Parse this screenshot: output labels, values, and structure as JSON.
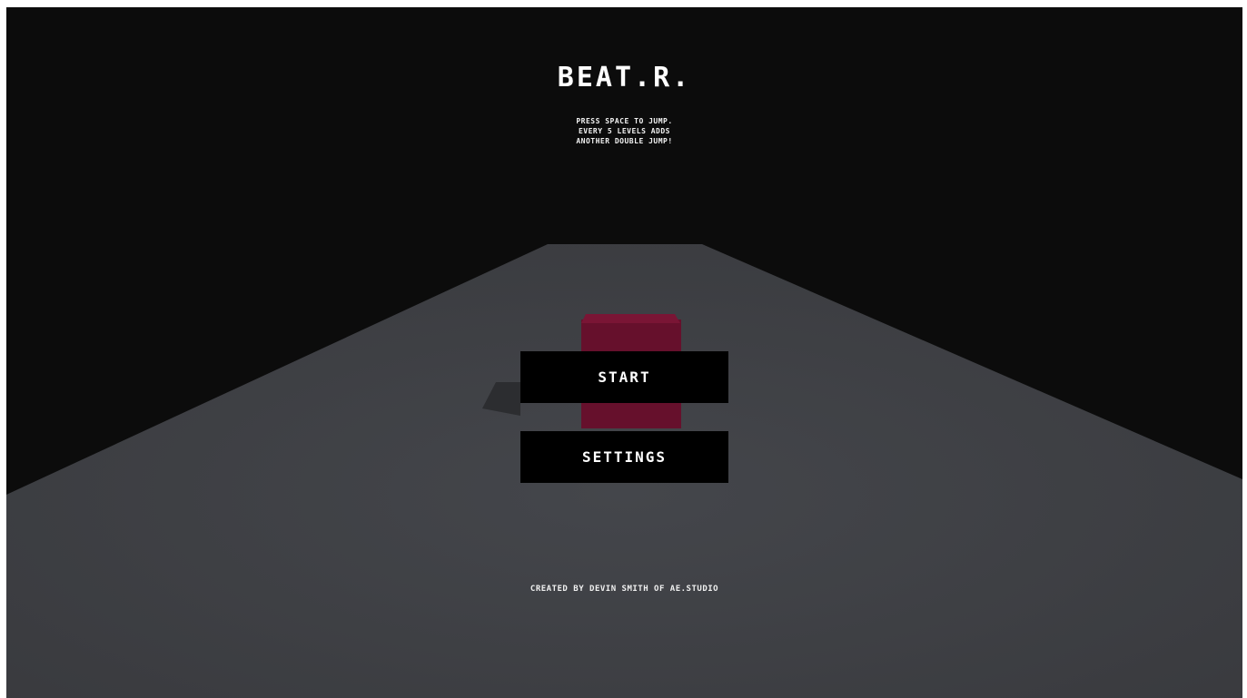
{
  "game": {
    "title": "BEAT.R.",
    "instructions": [
      "PRESS SPACE TO JUMP.",
      "EVERY 5 LEVELS ADDS",
      "ANOTHER DOUBLE JUMP!"
    ],
    "credits": "CREATED BY DEVIN SMITH OF AE.STUDIO"
  },
  "menu": {
    "start_label": "START",
    "settings_label": "SETTINGS"
  },
  "colors": {
    "background": "#0c0c0c",
    "floor": "#3a3c40",
    "cube": "#6a0f2c",
    "button": "#000000",
    "text": "#ffffff"
  }
}
